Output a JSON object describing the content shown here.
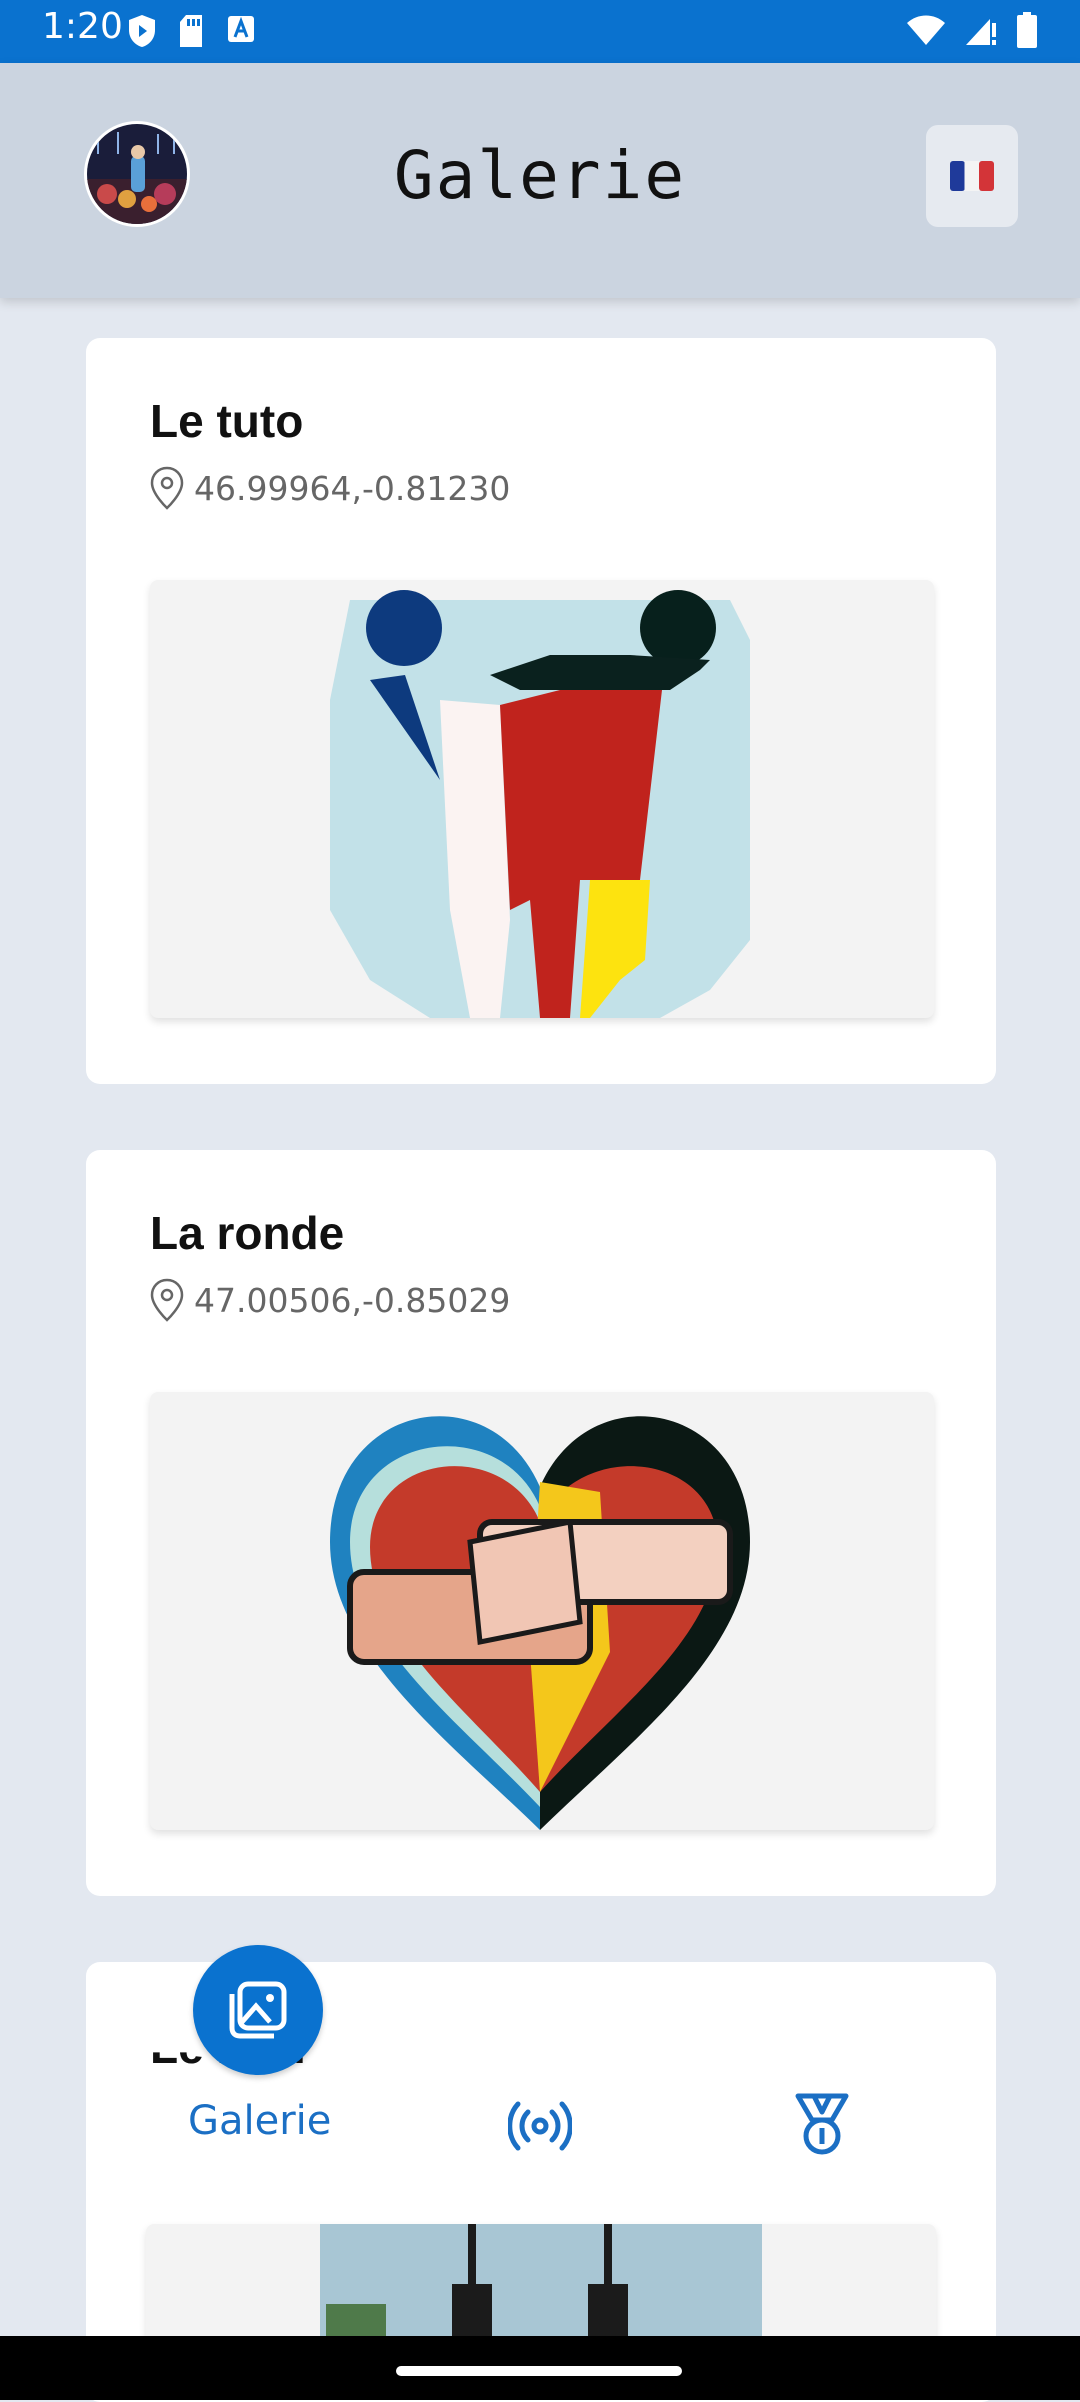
{
  "status_bar": {
    "time": "1:20"
  },
  "app_bar": {
    "title": "Galerie",
    "language_flag": "🇫🇷"
  },
  "cards": [
    {
      "title": "Le tuto",
      "coords": "46.99964,-0.81230"
    },
    {
      "title": "La ronde",
      "coords": "47.00506,-0.85029"
    },
    {
      "title": "Le ... er",
      "coords": ""
    }
  ],
  "bottom_nav": {
    "gallery_label": "Galerie"
  },
  "colors": {
    "accent": "#0a72cf",
    "background": "#e3e8f0",
    "appbar": "#cbd4e0"
  }
}
